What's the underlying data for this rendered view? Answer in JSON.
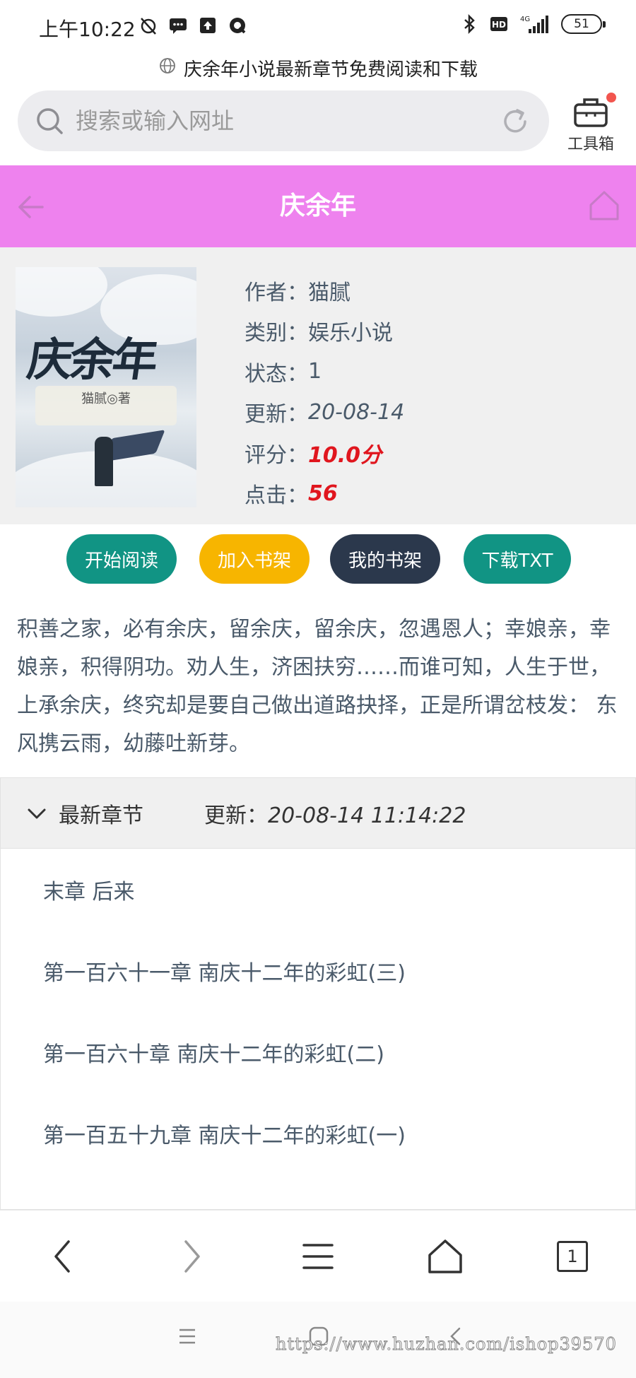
{
  "status_bar": {
    "time": "上午10:22",
    "battery": "51",
    "network": "4G"
  },
  "page_title": "庆余年小说最新章节免费阅读和下载",
  "browser": {
    "search_placeholder": "搜索或输入网址",
    "toolbox_label": "工具箱",
    "tab_count": "1"
  },
  "header": {
    "title": "庆余年",
    "color": "#ee82ee"
  },
  "book": {
    "cover_title": "庆余年",
    "cover_author": "猫腻◎著",
    "meta": [
      {
        "key": "作者：",
        "value": "猫腻"
      },
      {
        "key": "类别：",
        "value": "娱乐小说"
      },
      {
        "key": "状态：",
        "value": "1"
      },
      {
        "key": "更新：",
        "value": "20-08-14"
      },
      {
        "key": "评分：",
        "value": "10.0分"
      },
      {
        "key": "点击：",
        "value": "56"
      }
    ]
  },
  "actions": [
    {
      "label": "开始阅读",
      "color": "#119484"
    },
    {
      "label": "加入书架",
      "color": "#f7b500"
    },
    {
      "label": "我的书架",
      "color": "#2b384c"
    },
    {
      "label": "下载TXT",
      "color": "#119484"
    }
  ],
  "description": "积善之家，必有余庆，留余庆，留余庆，忽遇恩人；幸娘亲，幸娘亲，积得阴功。劝人生，济困扶穷……而谁可知，人生于世，上承余庆，终究却是要自己做出道路抉择，正是所谓岔枝发： 东风携云雨，幼藤吐新芽。",
  "chapters": {
    "title": "最新章节",
    "update_label": "更新：",
    "update_time": "20-08-14 11:14:22",
    "items": [
      "末章 后来",
      "第一百六十一章 南庆十二年的彩虹(三)",
      "第一百六十章 南庆十二年的彩虹(二)",
      "第一百五十九章 南庆十二年的彩虹(一)"
    ]
  },
  "watermark": "https://www.huzhan.com/ishop39570"
}
